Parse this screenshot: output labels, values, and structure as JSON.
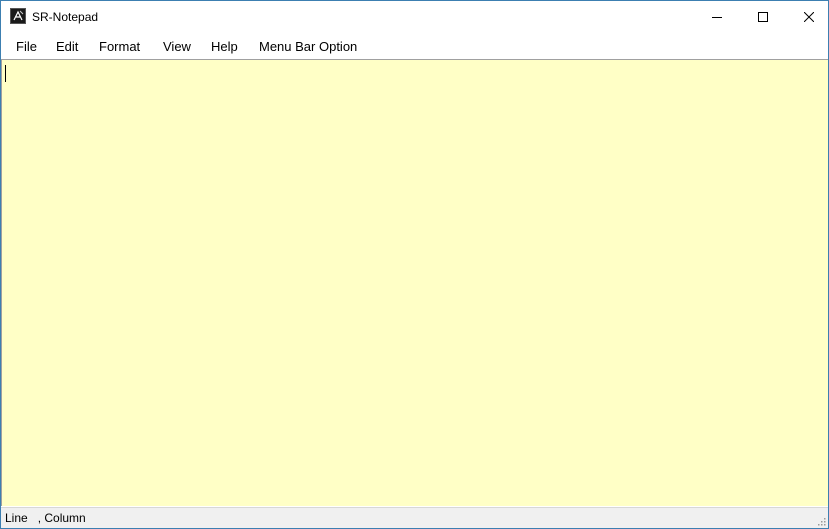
{
  "window": {
    "title": "SR-Notepad"
  },
  "menubar": {
    "items": [
      "File",
      "Edit",
      "Format",
      "View",
      "Help",
      "Menu Bar Option"
    ]
  },
  "editor": {
    "content": "",
    "background_color": "#ffffc6"
  },
  "statusbar": {
    "text": "Line   , Column"
  },
  "icons": {
    "app": "notepad-app-icon",
    "minimize": "minimize-icon",
    "maximize": "maximize-icon",
    "close": "close-icon",
    "grip": "resize-grip-icon"
  }
}
